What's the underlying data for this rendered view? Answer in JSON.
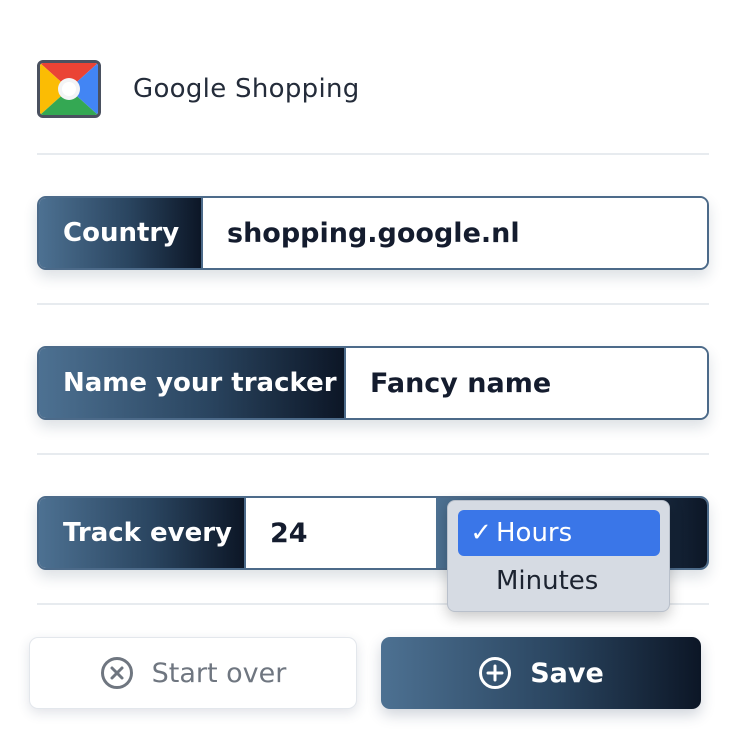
{
  "header": {
    "title": "Google Shopping",
    "logo_icon": "google-shopping-logo"
  },
  "fields": [
    {
      "label": "Country",
      "value": "shopping.google.nl"
    },
    {
      "label": "Name your tracker",
      "value": "Fancy name"
    },
    {
      "label": "Track every",
      "value": "24"
    }
  ],
  "interval_dropdown": {
    "options": [
      "Hours",
      "Minutes"
    ],
    "selected": "Hours",
    "check_glyph": "✓"
  },
  "buttons": {
    "start_over": "Start over",
    "save": "Save"
  },
  "colors": {
    "accent_dark": "#0c1626",
    "accent_light": "#4d7192",
    "selection_blue": "#3a76e8"
  }
}
